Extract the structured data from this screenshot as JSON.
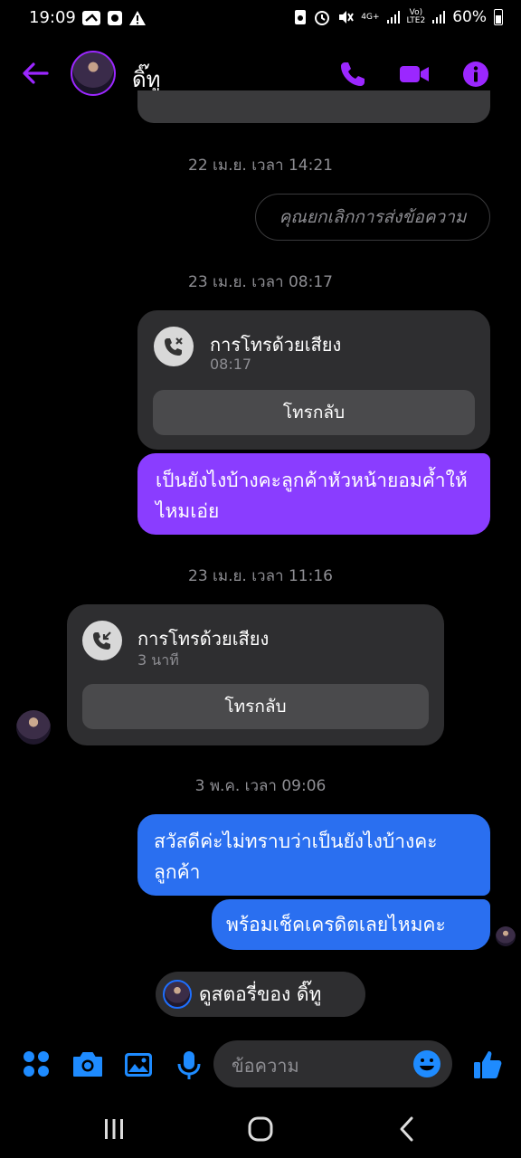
{
  "status_bar": {
    "time": "19:09",
    "net_label_1": "4G+",
    "net_label_2_top": "Vo)",
    "net_label_2_bottom": "LTE2",
    "battery": "60%"
  },
  "header": {
    "contact_name": "ดิ๊ทู",
    "accent_color": "#9b27ff"
  },
  "messages": {
    "stamp1": "22 เม.ย. เวลา 14:21",
    "unsent_text": "คุณยกเลิกการส่งข้อความ",
    "stamp2": "23 เม.ย. เวลา 08:17",
    "call1": {
      "title": "การโทรด้วยเสียง",
      "subtitle": "08:17",
      "button": "โทรกลับ"
    },
    "bubble1": "เป็นยังไงบ้างคะลูกค้าหัวหน้ายอมค้ำให้ไหมเอ่ย",
    "stamp3": "23 เม.ย. เวลา 11:16",
    "call2": {
      "title": "การโทรด้วยเสียง",
      "subtitle": "3 นาที",
      "button": "โทรกลับ"
    },
    "stamp4": "3 พ.ค. เวลา 09:06",
    "bubble2": "สวัสดีค่ะไม่ทราบว่าเป็นยังไงบ้างคะลูกค้า",
    "bubble3": "พร้อมเช็คเครดิตเลยไหมคะ",
    "story_link": "ดูสตอรี่ของ ดิ๊ทู"
  },
  "composer": {
    "placeholder": "ข้อความ"
  },
  "colors": {
    "purple_bubble": "#8a3dff",
    "blue_bubble": "#2a6ff0",
    "accent_blue": "#1e8bff"
  }
}
